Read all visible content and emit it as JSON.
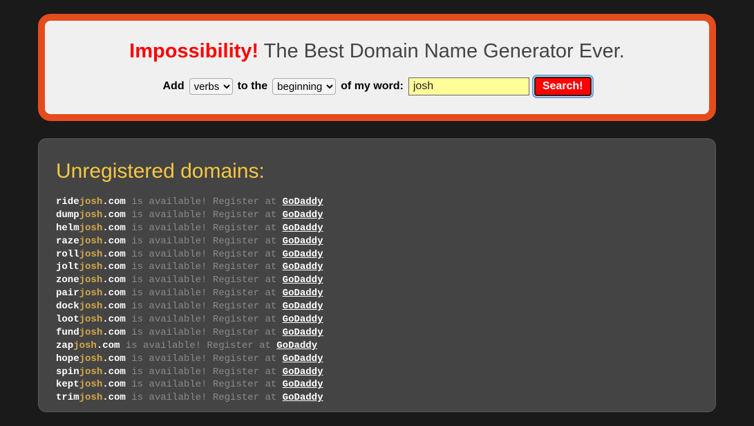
{
  "header": {
    "brand": "Impossibility!",
    "tagline": " The Best Domain Name Generator Ever."
  },
  "controls": {
    "add_label": "Add",
    "type_select": "verbs",
    "to_the_label": "to the",
    "position_select": "beginning",
    "of_my_word_label": "of my word:",
    "word_value": "josh",
    "search_label": "Search!"
  },
  "results": {
    "heading": "Unregistered domains:",
    "available_text": " is available! Register at ",
    "registrar": "GoDaddy",
    "word": "josh",
    "tld": ".com",
    "prefixes": [
      "ride",
      "dump",
      "helm",
      "raze",
      "roll",
      "jolt",
      "zone",
      "pair",
      "dock",
      "loot",
      "fund",
      "zap",
      "hope",
      "spin",
      "kept",
      "trim"
    ]
  }
}
